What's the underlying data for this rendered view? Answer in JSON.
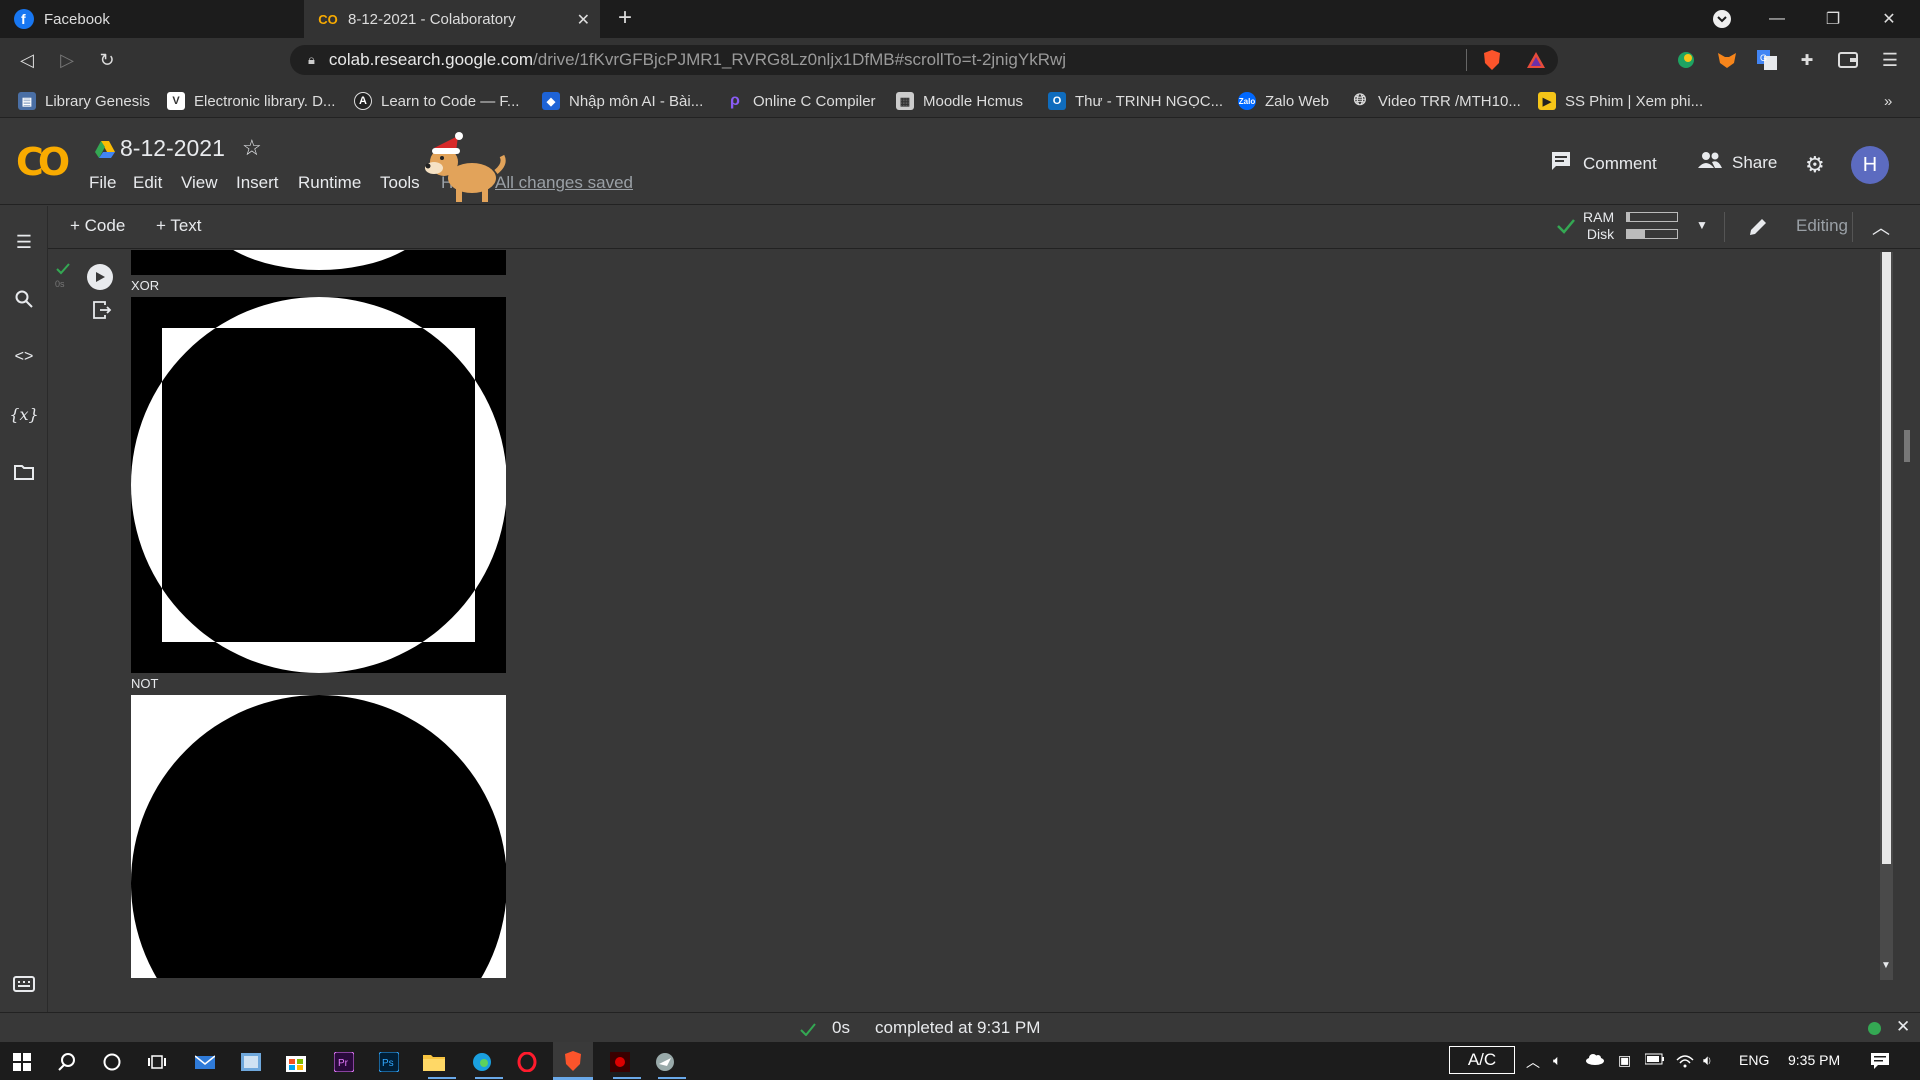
{
  "browser": {
    "tabs": [
      {
        "title": "Facebook",
        "active": false
      },
      {
        "title": "8-12-2021 - Colaboratory",
        "active": true
      }
    ],
    "new_tab_symbol": "+",
    "address": {
      "host": "colab.research.google.com",
      "path": "/drive/1fKvrGFBjcPJMR1_RVRG8Lz0nljx1DfMB#scrollTo=t-2jnigYkRwj"
    },
    "bookmarks": [
      "Library Genesis",
      "Electronic library. D...",
      "Learn to Code — F...",
      "Nhập môn AI - Bài...",
      "Online C Compiler",
      "Moodle Hcmus",
      "Thư - TRINH NGỌC...",
      "Zalo Web",
      "Video TRR /MTH10...",
      "SS Phim | Xem phi..."
    ],
    "more_bookmarks": "»"
  },
  "colab": {
    "logo": "CO",
    "doc_title": "8-12-2021",
    "menu": [
      "File",
      "Edit",
      "View",
      "Insert",
      "Runtime",
      "Tools",
      "Help"
    ],
    "saved_status": "All changes saved",
    "comment_label": "Comment",
    "share_label": "Share",
    "avatar_letter": "H",
    "toolbar": {
      "add_code": "+ Code",
      "add_text": "+ Text",
      "ram_label": "RAM",
      "disk_label": "Disk",
      "ram_fill": 0.05,
      "disk_fill": 0.35,
      "editing_label": "Editing"
    },
    "cell": {
      "exec_time": "0s",
      "outputs": [
        {
          "label": "XOR"
        },
        {
          "label": "NOT"
        }
      ]
    },
    "status": {
      "duration": "0s",
      "message": "completed at 9:31 PM"
    }
  },
  "taskbar": {
    "tray": {
      "keyboard_box": "A/C",
      "language": "ENG",
      "time": "9:35 PM"
    }
  },
  "colors": {
    "accent_orange": "#f9ab00",
    "check_green": "#34a853",
    "avatar_bg": "#5c6bc0"
  }
}
